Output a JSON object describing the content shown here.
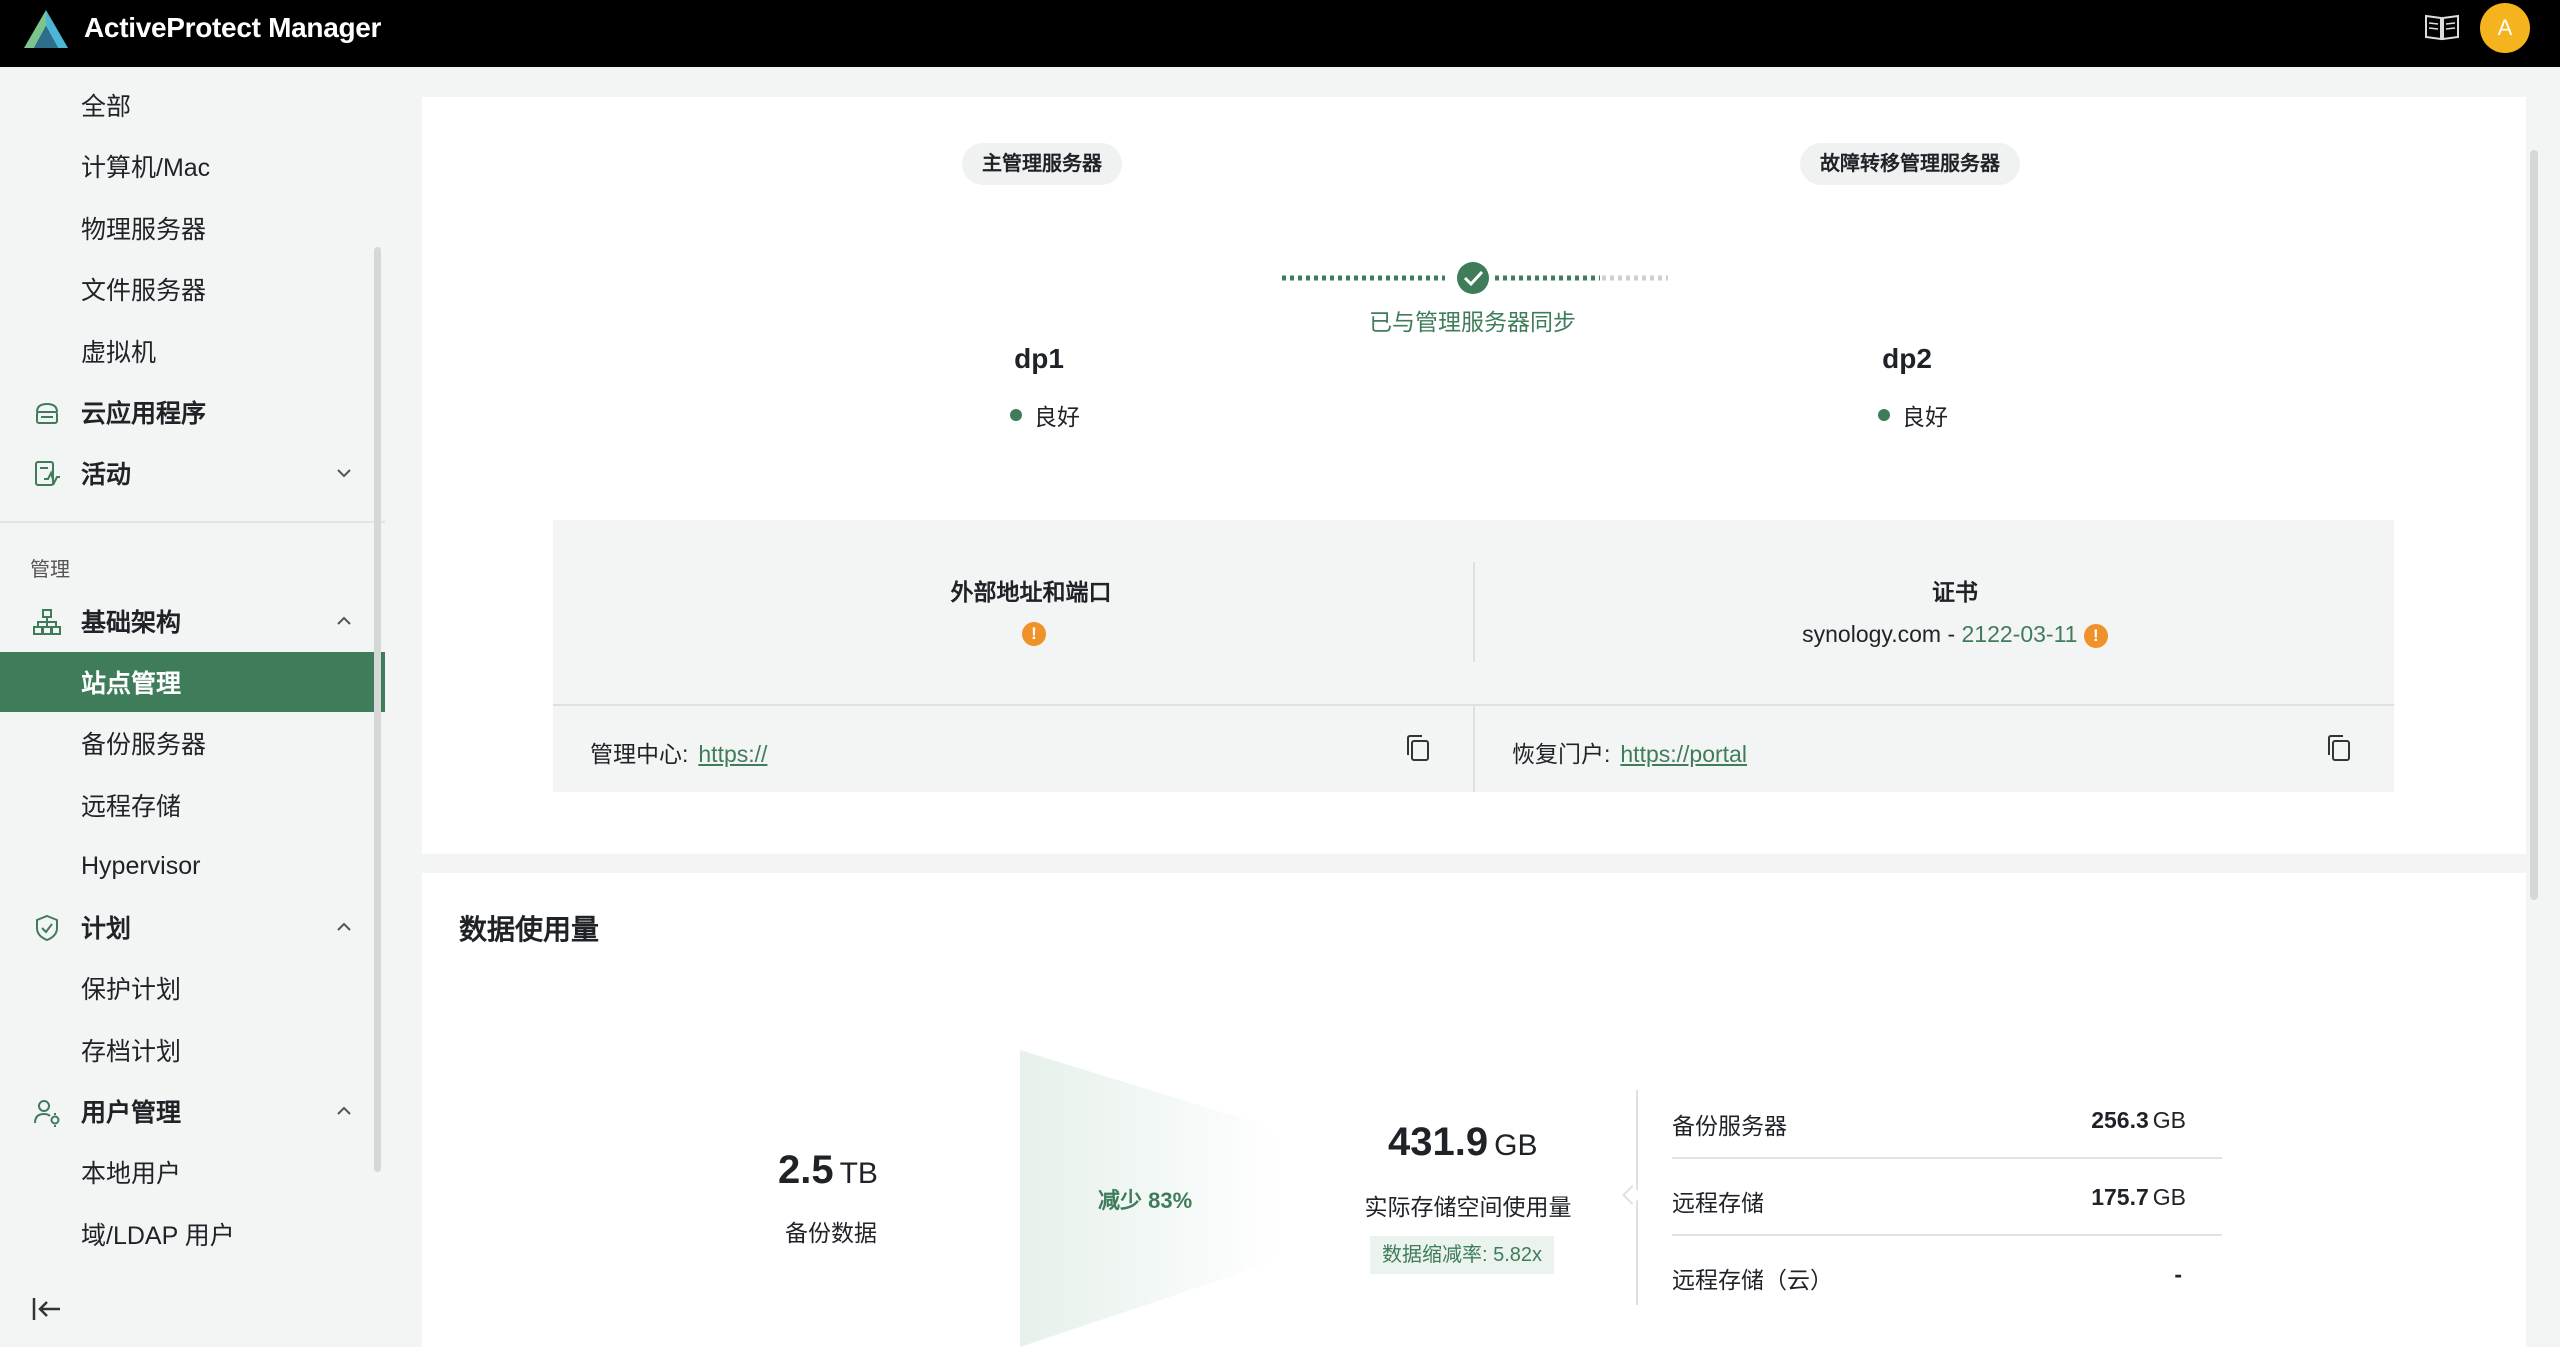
{
  "app": {
    "title": "ActiveProtect Manager",
    "avatar_letter": "A",
    "accent": "#3f7c5a"
  },
  "sidebar": {
    "items_top": [
      {
        "label": "全部"
      },
      {
        "label": "计算机/Mac"
      },
      {
        "label": "物理服务器"
      },
      {
        "label": "文件服务器"
      },
      {
        "label": "虚拟机"
      }
    ],
    "cloud_apps": {
      "label": "云应用程序",
      "icon": "cloud-app-icon"
    },
    "activity": {
      "label": "活动",
      "icon": "activity-icon"
    },
    "section_manage": "管理",
    "infrastructure": {
      "label": "基础架构",
      "icon": "network-icon"
    },
    "infra_items": [
      {
        "label": "站点管理",
        "active": true
      },
      {
        "label": "备份服务器"
      },
      {
        "label": "远程存储"
      },
      {
        "label": "Hypervisor"
      }
    ],
    "plans": {
      "label": "计划",
      "icon": "shield-check-icon"
    },
    "plan_items": [
      {
        "label": "保护计划"
      },
      {
        "label": "存档计划"
      }
    ],
    "users": {
      "label": "用户管理",
      "icon": "user-gear-icon"
    },
    "user_items": [
      {
        "label": "本地用户"
      },
      {
        "label": "域/LDAP 用户"
      }
    ]
  },
  "site": {
    "primary_label": "主管理服务器",
    "failover_label": "故障转移管理服务器",
    "sync_text": "已与管理服务器同步",
    "primary_name": "dp1",
    "primary_status": "良好",
    "failover_name": "dp2",
    "failover_status": "良好",
    "external_title": "外部地址和端口",
    "cert_title": "证书",
    "cert_domain": "synology.com - ",
    "cert_date": "2122-03-11",
    "mgmt_label": "管理中心:",
    "mgmt_link": "https://",
    "portal_label": "恢复门户:",
    "portal_link": "https://portal"
  },
  "usage": {
    "title": "数据使用量",
    "backup_value": "2.5",
    "backup_unit": "TB",
    "backup_label": "备份数据",
    "reduce_text": "减少 83%",
    "actual_value": "431.9",
    "actual_unit": "GB",
    "actual_label": "实际存储空间使用量",
    "ratio_text": "数据缩减率: 5.82x",
    "rows": [
      {
        "name": "备份服务器",
        "value": "256.3",
        "unit": "GB"
      },
      {
        "name": "远程存储",
        "value": "175.7",
        "unit": "GB"
      },
      {
        "name": "远程存储（云）",
        "value": "-",
        "unit": ""
      }
    ]
  }
}
